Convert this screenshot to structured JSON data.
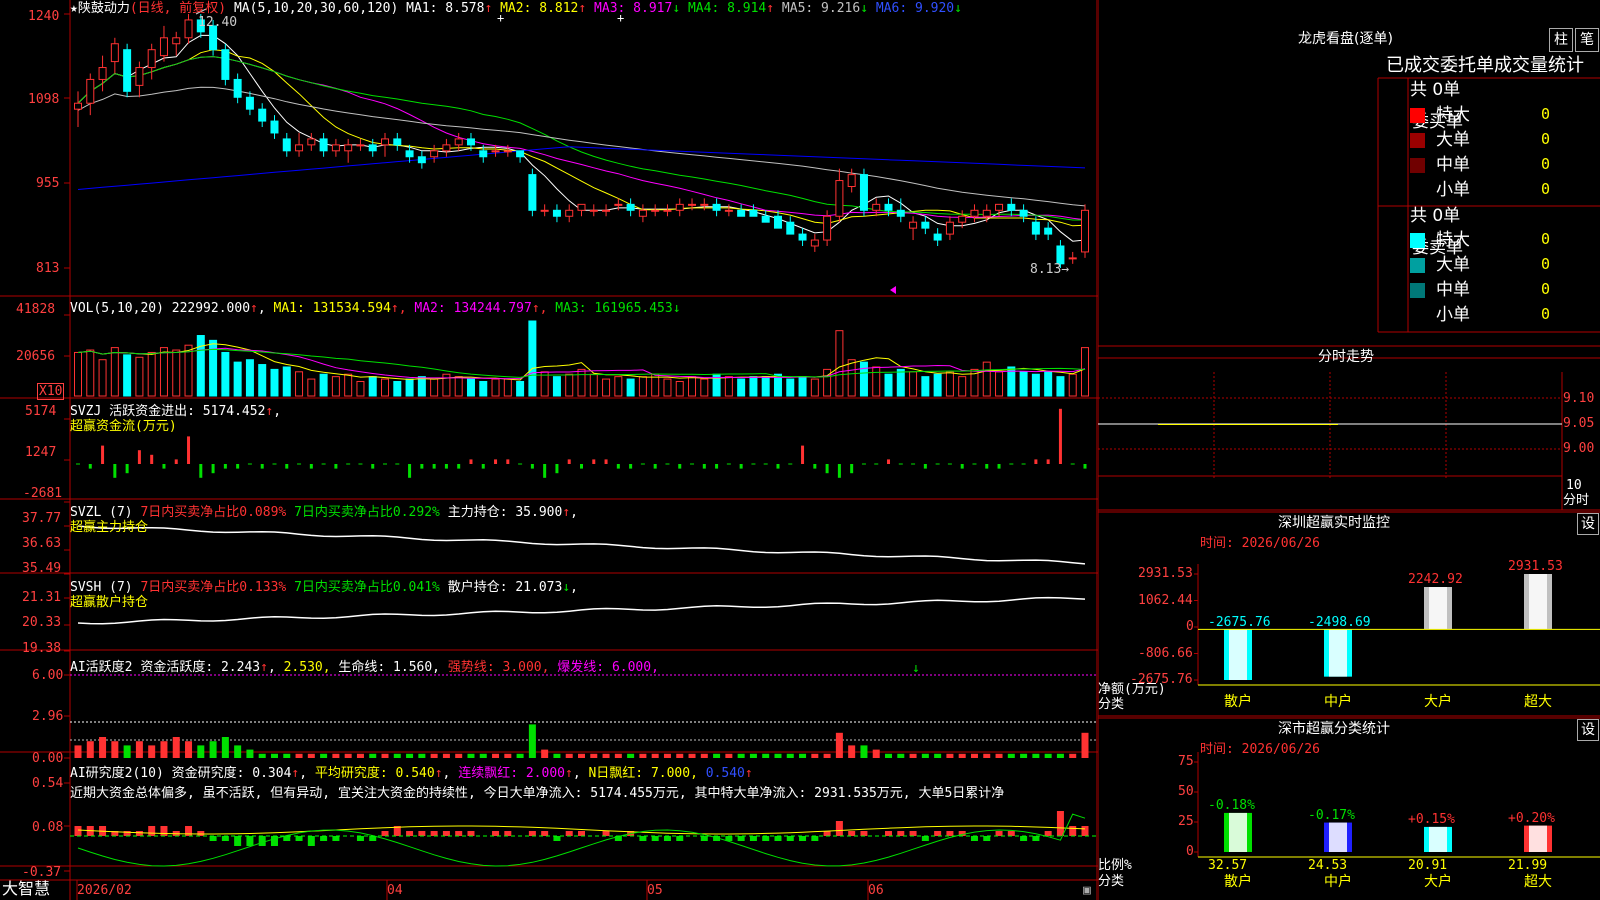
{
  "stock": {
    "name": "陕鼓动力",
    "period": "(日线, 前复权)"
  },
  "colors": {
    "up": "#ff3232",
    "down": "#00ffff",
    "ma1": "#ffffff",
    "ma2": "#ffff00",
    "ma3": "#ff00ff",
    "ma4": "#00e000",
    "ma5": "#c0c0c0",
    "ma6": "#0000ff",
    "grid": "#b00000",
    "axis": "#ff4040"
  },
  "price_panel": {
    "header": "★陕鼓动力",
    "period": "(日线, 前复权)",
    "ma_title": "MA(5,10,20,30,60,120)",
    "ma": [
      {
        "label": "MA1: 8.578",
        "arrow": "↑"
      },
      {
        "label": "MA2: 8.812",
        "arrow": "↑"
      },
      {
        "label": "MA3: 8.917",
        "arrow": "↓"
      },
      {
        "label": "MA4: 8.914",
        "arrow": "↑"
      },
      {
        "label": "MA5: 9.216",
        "arrow": "↓"
      },
      {
        "label": "MA6: 9.920",
        "arrow": "↓"
      }
    ],
    "yticks": [
      "1240",
      "1098",
      "955",
      "813"
    ],
    "high_mark": "12.40",
    "low_mark": "8.13→"
  },
  "vol_panel": {
    "title": "VOL(5,10,20)",
    "value": "222992.000",
    "arrow": "↑",
    "ma1": "MA1: 131534.594",
    "ma2": "MA2: 134244.797",
    "ma3": "MA3: 161965.453",
    "yticks": [
      "41828",
      "20656"
    ],
    "unit": "X10"
  },
  "svzj_panel": {
    "title": "SVZJ",
    "desc": "活跃资金进出: 5174.452",
    "sub": "超赢资金流(万元)",
    "yticks": [
      "5174",
      "1247",
      "-2681"
    ]
  },
  "svzl_panel": {
    "title": "SVZL (7)",
    "a": "7日内买卖净占比0.089%",
    "b": "7日内买卖净占比0.292%",
    "c": "主力持仓: 35.900",
    "sub": "超赢主力持仓",
    "yticks": [
      "37.77",
      "36.63",
      "35.49"
    ]
  },
  "svsh_panel": {
    "title": "SVSH (7)",
    "a": "7日内买卖净占比0.133%",
    "b": "7日内买卖净占比0.041%",
    "c": "散户持仓: 21.073",
    "sub": "超赢散户持仓",
    "yticks": [
      "21.31",
      "20.33",
      "19.38"
    ]
  },
  "ai1_panel": {
    "title": "AI活跃度2",
    "a": "资金活跃度: 2.243",
    "b": "2.530,",
    "c": "生命线: 1.560,",
    "d": "强势线: 3.000,",
    "e": "爆发线: 6.000,",
    "yticks": [
      "6.00",
      "2.96",
      "0.00"
    ]
  },
  "ai2_panel": {
    "title": "AI研究度2(10)",
    "a": "资金研究度: 0.304",
    "b": "平均研究度: 0.540",
    "c": "连续飘红: 2.000",
    "d": "N日飘红: 7.000,",
    "e": "0.540",
    "comment": "近期大资金总体偏多, 虽不活跃, 但有异动, 宜关注大资金的持续性, 今日大单净流入: 5174.455万元, 其中特大单净流入: 2931.535万元, 大单5日累计净",
    "yticks": [
      "0.54",
      "0.08",
      "-0.37"
    ]
  },
  "xaxis": {
    "labels": [
      "2026/02",
      "04",
      "05",
      "06"
    ],
    "brand": "大智慧"
  },
  "dragon": {
    "title": "龙虎看盘(逐单)",
    "btn1": "柱",
    "btn2": "笔",
    "tabs": [
      "已成交",
      "委托单",
      "成交量统计"
    ],
    "buy": {
      "side": "委买单",
      "total": "共 0单",
      "rows": [
        {
          "name": "特大",
          "val": "0",
          "color": "#ff0000"
        },
        {
          "name": "大单",
          "val": "0",
          "color": "#9a0000"
        },
        {
          "name": "中单",
          "val": "0",
          "color": "#700000"
        },
        {
          "name": "小单",
          "val": "0",
          "color": "#000000"
        }
      ]
    },
    "sell": {
      "side": "委卖单",
      "total": "共 0单",
      "rows": [
        {
          "name": "特大",
          "val": "0",
          "color": "#00ffff"
        },
        {
          "name": "大单",
          "val": "0",
          "color": "#00a0a0"
        },
        {
          "name": "中单",
          "val": "0",
          "color": "#007878"
        },
        {
          "name": "小单",
          "val": "0",
          "color": "#000000"
        }
      ]
    }
  },
  "intraday": {
    "title": "分时走势",
    "yticks": [
      "9.10",
      "9.05",
      "9.00"
    ],
    "x1": "10",
    "x2": "分时"
  },
  "sz_monitor": {
    "title": "深圳超赢实时监控",
    "btn": "设",
    "time": "时间: 2026/06/26",
    "yticks": [
      "2931.53",
      "1062.44",
      "0",
      "-806.66",
      "-2675.76"
    ],
    "ylabel": "净额(万元)",
    "xlabel": "分类",
    "categories": [
      "散户",
      "中户",
      "大户",
      "超大"
    ],
    "values": [
      -2675.76,
      -2498.69,
      2242.92,
      2931.53
    ],
    "value_labels": [
      "-2675.76",
      "-2498.69",
      "2242.92",
      "2931.53"
    ]
  },
  "sz_stats": {
    "title": "深市超赢分类统计",
    "btn": "设",
    "time": "时间: 2026/06/26",
    "yticks": [
      "75",
      "50",
      "25",
      "0"
    ],
    "ylabel": "比例%",
    "xlabel": "分类",
    "categories": [
      "散户",
      "中户",
      "大户",
      "超大"
    ],
    "values": [
      32.57,
      24.53,
      20.91,
      21.99
    ],
    "value_labels": [
      "32.57",
      "24.53",
      "20.91",
      "21.99"
    ],
    "changes": [
      "-0.18%",
      "-0.17%",
      "+0.15%",
      "+0.20%"
    ]
  },
  "chart_data": {
    "type": "candlestick",
    "title": "陕鼓动力 (日线, 前复权)",
    "ylim": [
      8.13,
      12.4
    ],
    "candles": [
      {
        "o": 10.8,
        "h": 11.1,
        "l": 10.5,
        "c": 10.9
      },
      {
        "o": 10.9,
        "h": 11.4,
        "l": 10.7,
        "c": 11.3
      },
      {
        "o": 11.3,
        "h": 11.7,
        "l": 11.1,
        "c": 11.5
      },
      {
        "o": 11.6,
        "h": 12.0,
        "l": 11.4,
        "c": 11.9
      },
      {
        "o": 11.8,
        "h": 11.9,
        "l": 11.0,
        "c": 11.1
      },
      {
        "o": 11.2,
        "h": 11.6,
        "l": 11.0,
        "c": 11.5
      },
      {
        "o": 11.5,
        "h": 11.9,
        "l": 11.3,
        "c": 11.8
      },
      {
        "o": 11.7,
        "h": 12.2,
        "l": 11.6,
        "c": 12.0
      },
      {
        "o": 11.9,
        "h": 12.1,
        "l": 11.7,
        "c": 12.0
      },
      {
        "o": 12.0,
        "h": 12.4,
        "l": 11.9,
        "c": 12.3
      },
      {
        "o": 12.3,
        "h": 12.4,
        "l": 12.0,
        "c": 12.1
      },
      {
        "o": 12.2,
        "h": 12.3,
        "l": 11.7,
        "c": 11.8
      },
      {
        "o": 11.8,
        "h": 11.9,
        "l": 11.2,
        "c": 11.3
      },
      {
        "o": 11.3,
        "h": 11.4,
        "l": 10.9,
        "c": 11.0
      },
      {
        "o": 11.0,
        "h": 11.1,
        "l": 10.7,
        "c": 10.8
      },
      {
        "o": 10.8,
        "h": 10.9,
        "l": 10.5,
        "c": 10.6
      },
      {
        "o": 10.6,
        "h": 10.7,
        "l": 10.3,
        "c": 10.4
      },
      {
        "o": 10.3,
        "h": 10.4,
        "l": 10.0,
        "c": 10.1
      },
      {
        "o": 10.1,
        "h": 10.4,
        "l": 10.0,
        "c": 10.2
      },
      {
        "o": 10.2,
        "h": 10.4,
        "l": 10.1,
        "c": 10.3
      },
      {
        "o": 10.3,
        "h": 10.4,
        "l": 10.0,
        "c": 10.1
      },
      {
        "o": 10.1,
        "h": 10.3,
        "l": 10.0,
        "c": 10.2
      },
      {
        "o": 10.1,
        "h": 10.3,
        "l": 9.9,
        "c": 10.2
      },
      {
        "o": 10.2,
        "h": 10.3,
        "l": 10.1,
        "c": 10.2
      },
      {
        "o": 10.2,
        "h": 10.3,
        "l": 10.0,
        "c": 10.1
      },
      {
        "o": 10.2,
        "h": 10.4,
        "l": 10.0,
        "c": 10.3
      },
      {
        "o": 10.3,
        "h": 10.4,
        "l": 10.1,
        "c": 10.2
      },
      {
        "o": 10.1,
        "h": 10.2,
        "l": 9.9,
        "c": 10.0
      },
      {
        "o": 10.0,
        "h": 10.1,
        "l": 9.8,
        "c": 9.9
      },
      {
        "o": 10.0,
        "h": 10.2,
        "l": 9.9,
        "c": 10.1
      },
      {
        "o": 10.1,
        "h": 10.3,
        "l": 10.0,
        "c": 10.2
      },
      {
        "o": 10.2,
        "h": 10.4,
        "l": 10.1,
        "c": 10.3
      },
      {
        "o": 10.3,
        "h": 10.4,
        "l": 10.1,
        "c": 10.2
      },
      {
        "o": 10.1,
        "h": 10.2,
        "l": 9.9,
        "c": 10.0
      },
      {
        "o": 10.1,
        "h": 10.2,
        "l": 10.0,
        "c": 10.1
      },
      {
        "o": 10.1,
        "h": 10.2,
        "l": 10.0,
        "c": 10.1
      },
      {
        "o": 10.1,
        "h": 10.1,
        "l": 9.9,
        "c": 10.0
      },
      {
        "o": 9.7,
        "h": 9.8,
        "l": 9.0,
        "c": 9.1
      },
      {
        "o": 9.1,
        "h": 9.2,
        "l": 9.0,
        "c": 9.1
      },
      {
        "o": 9.1,
        "h": 9.2,
        "l": 8.9,
        "c": 9.0
      },
      {
        "o": 9.0,
        "h": 9.2,
        "l": 8.9,
        "c": 9.1
      },
      {
        "o": 9.1,
        "h": 9.2,
        "l": 9.0,
        "c": 9.2
      },
      {
        "o": 9.1,
        "h": 9.2,
        "l": 9.0,
        "c": 9.1
      },
      {
        "o": 9.1,
        "h": 9.2,
        "l": 9.0,
        "c": 9.1
      },
      {
        "o": 9.2,
        "h": 9.3,
        "l": 9.1,
        "c": 9.2
      },
      {
        "o": 9.2,
        "h": 9.3,
        "l": 9.0,
        "c": 9.1
      },
      {
        "o": 9.0,
        "h": 9.2,
        "l": 8.9,
        "c": 9.1
      },
      {
        "o": 9.1,
        "h": 9.2,
        "l": 9.0,
        "c": 9.1
      },
      {
        "o": 9.1,
        "h": 9.2,
        "l": 9.0,
        "c": 9.1
      },
      {
        "o": 9.1,
        "h": 9.3,
        "l": 9.0,
        "c": 9.2
      },
      {
        "o": 9.2,
        "h": 9.3,
        "l": 9.1,
        "c": 9.2
      },
      {
        "o": 9.2,
        "h": 9.3,
        "l": 9.1,
        "c": 9.2
      },
      {
        "o": 9.2,
        "h": 9.3,
        "l": 9.0,
        "c": 9.1
      },
      {
        "o": 9.1,
        "h": 9.2,
        "l": 9.0,
        "c": 9.1
      },
      {
        "o": 9.1,
        "h": 9.2,
        "l": 9.0,
        "c": 9.0
      },
      {
        "o": 9.1,
        "h": 9.2,
        "l": 9.0,
        "c": 9.0
      },
      {
        "o": 9.0,
        "h": 9.1,
        "l": 8.9,
        "c": 8.9
      },
      {
        "o": 9.0,
        "h": 9.1,
        "l": 8.8,
        "c": 8.8
      },
      {
        "o": 8.9,
        "h": 9.0,
        "l": 8.7,
        "c": 8.7
      },
      {
        "o": 8.7,
        "h": 8.8,
        "l": 8.5,
        "c": 8.6
      },
      {
        "o": 8.5,
        "h": 8.7,
        "l": 8.4,
        "c": 8.6
      },
      {
        "o": 8.6,
        "h": 9.1,
        "l": 8.5,
        "c": 9.0
      },
      {
        "o": 9.0,
        "h": 9.8,
        "l": 8.9,
        "c": 9.6
      },
      {
        "o": 9.5,
        "h": 9.8,
        "l": 9.4,
        "c": 9.7
      },
      {
        "o": 9.7,
        "h": 9.8,
        "l": 9.0,
        "c": 9.1
      },
      {
        "o": 9.1,
        "h": 9.3,
        "l": 9.0,
        "c": 9.2
      },
      {
        "o": 9.2,
        "h": 9.3,
        "l": 9.0,
        "c": 9.1
      },
      {
        "o": 9.1,
        "h": 9.3,
        "l": 8.9,
        "c": 9.0
      },
      {
        "o": 8.8,
        "h": 9.0,
        "l": 8.6,
        "c": 8.9
      },
      {
        "o": 8.9,
        "h": 9.0,
        "l": 8.7,
        "c": 8.8
      },
      {
        "o": 8.7,
        "h": 8.8,
        "l": 8.5,
        "c": 8.6
      },
      {
        "o": 8.7,
        "h": 9.0,
        "l": 8.6,
        "c": 8.9
      },
      {
        "o": 8.9,
        "h": 9.1,
        "l": 8.8,
        "c": 9.0
      },
      {
        "o": 9.0,
        "h": 9.2,
        "l": 8.9,
        "c": 9.1
      },
      {
        "o": 9.0,
        "h": 9.2,
        "l": 8.9,
        "c": 9.1
      },
      {
        "o": 9.1,
        "h": 9.2,
        "l": 9.0,
        "c": 9.2
      },
      {
        "o": 9.2,
        "h": 9.3,
        "l": 9.0,
        "c": 9.1
      },
      {
        "o": 9.1,
        "h": 9.2,
        "l": 8.9,
        "c": 9.0
      },
      {
        "o": 8.9,
        "h": 9.0,
        "l": 8.6,
        "c": 8.7
      },
      {
        "o": 8.8,
        "h": 8.9,
        "l": 8.6,
        "c": 8.7
      },
      {
        "o": 8.5,
        "h": 8.6,
        "l": 8.13,
        "c": 8.2
      },
      {
        "o": 8.3,
        "h": 8.4,
        "l": 8.2,
        "c": 8.3
      },
      {
        "o": 8.4,
        "h": 9.2,
        "l": 8.3,
        "c": 9.1
      }
    ]
  }
}
